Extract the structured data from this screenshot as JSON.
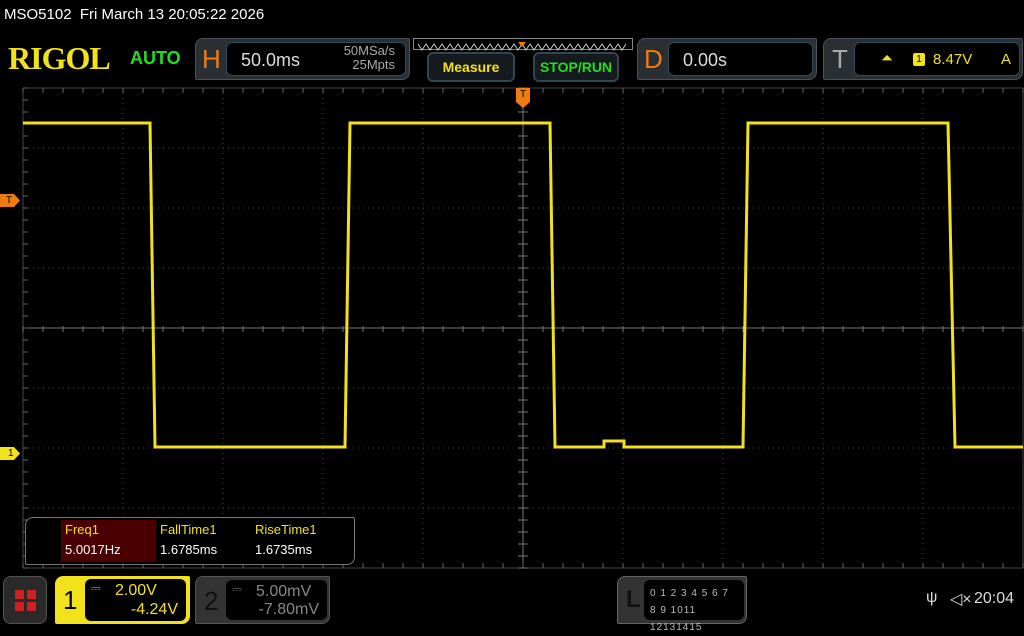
{
  "titlebar": {
    "model": "MSO5102",
    "datetime": "Fri March 13 20:05:22 2026"
  },
  "header": {
    "logo": "RIGOL",
    "trigger_status": "AUTO",
    "horizontal": {
      "letter": "H",
      "timebase": "50.0ms",
      "sample_rate": "50MSa/s",
      "memory_depth": "25Mpts"
    },
    "measure_label": "Measure",
    "stoprun_label": "STOP/RUN",
    "delay": {
      "letter": "D",
      "value": "0.00s"
    },
    "trigger": {
      "letter": "T",
      "slope_icon": "rising-edge-icon",
      "source": "1",
      "level": "8.47V",
      "mode": "A"
    }
  },
  "markers": {
    "trigger_level": "T",
    "ch1_offset": "1",
    "trigger_position": "T"
  },
  "measurements": [
    {
      "name": "Freq1",
      "value": "5.0017Hz"
    },
    {
      "name": "FallTime1",
      "value": "1.6785ms"
    },
    {
      "name": "RiseTime1",
      "value": "1.6735ms"
    }
  ],
  "channels": [
    {
      "number": "1",
      "coupling_icon": "dc-coupling-icon",
      "scale": "2.00V",
      "offset": "-4.24V",
      "color": "#f2e21b",
      "active": true
    },
    {
      "number": "2",
      "coupling_icon": "dc-coupling-icon",
      "scale": "5.00mV",
      "offset": "-7.80mV",
      "color": "#888888",
      "active": false
    }
  ],
  "logic": {
    "letter": "L",
    "row1": "0 1 2 3  4 5 6 7",
    "row2": "8 9 1011 12131415"
  },
  "status": {
    "usb_icon": "usb-icon",
    "sound_icon": "muted-speaker-icon",
    "time": "20:04"
  },
  "colors": {
    "trace": "#f2e21b",
    "accent": "#f07c10",
    "grid": "#555555"
  }
}
